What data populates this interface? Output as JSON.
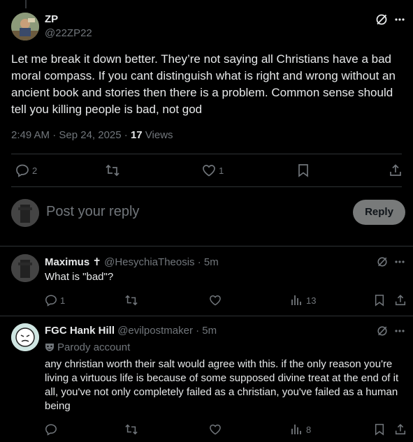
{
  "main_post": {
    "author_name": "ZP",
    "author_handle": "@22ZP22",
    "text": "Let me break it down better. They’re not saying all Christians have a bad moral compass. If you cant distinguish what is right and wrong without an ancient book and stories then there is a problem. Common sense should tell you killing people is bad, not god",
    "timestamp": "2:49 AM · Sep 24, 2025 · ",
    "views_count": "17",
    "views_label": " Views",
    "reply_count": "2",
    "like_count": "1"
  },
  "compose": {
    "placeholder": "Post your reply",
    "reply_button": "Reply"
  },
  "replies": [
    {
      "author_name": "Maximus ✝",
      "author_handle": "@HesychiaTheosis · 5m",
      "text": "What is \"bad\"?",
      "reply_count": "1",
      "views_count": "13"
    },
    {
      "author_name": "FGC Hank Hill",
      "author_handle": "@evilpostmaker · 5m",
      "label": "Parody account",
      "text": "any christian worth their salt would agree with this. if the only reason you're living a virtuous life is because of some supposed divine treat at the end of it all, you've not only completely failed as a christian, you've failed as a human being",
      "views_count": "8"
    }
  ],
  "colors": {
    "background": "#000000",
    "text": "#e7e9ea",
    "muted": "#71767b",
    "divider": "#2f3336",
    "reply_button_bg": "#787a7a"
  }
}
